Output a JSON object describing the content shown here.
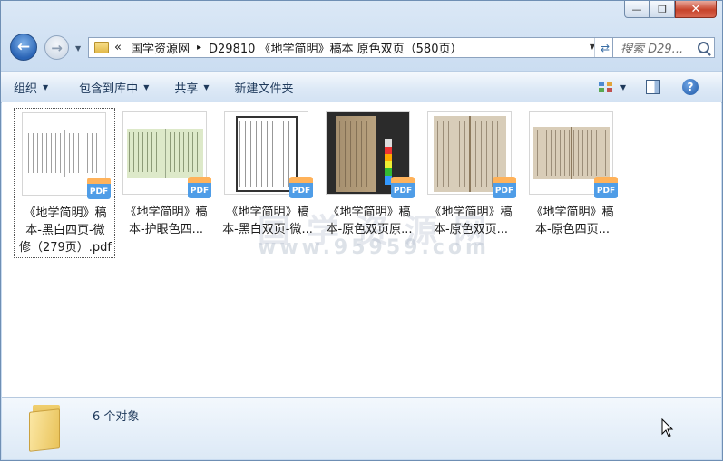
{
  "window": {
    "minimize_label": "—",
    "maximize_label": "❐",
    "close_label": "✕"
  },
  "address_bar": {
    "overflow_label": "«",
    "crumbs": [
      "国学资源网",
      "D29810 《地学简明》稿本 原色双页（580页）"
    ],
    "separator": "▸"
  },
  "search": {
    "placeholder": "搜索 D29..."
  },
  "toolbar": {
    "organize_label": "组织",
    "include_label": "包含到库中",
    "share_label": "共享",
    "new_folder_label": "新建文件夹"
  },
  "files": [
    {
      "name_line1": "《地学简明》稿",
      "name_line2": "本-黑白四页-微",
      "name_line3": "修（279页）.pdf",
      "badge": "PDF"
    },
    {
      "name_line1": "《地学简明》稿",
      "name_line2": "本-护眼色四...",
      "name_line3": "",
      "badge": "PDF"
    },
    {
      "name_line1": "《地学简明》稿",
      "name_line2": "本-黑白双页-微...",
      "name_line3": "",
      "badge": "PDF"
    },
    {
      "name_line1": "《地学简明》稿",
      "name_line2": "本-原色双页原...",
      "name_line3": "",
      "badge": "PDF"
    },
    {
      "name_line1": "《地学简明》稿",
      "name_line2": "本-原色双页...",
      "name_line3": "",
      "badge": "PDF"
    },
    {
      "name_line1": "《地学简明》稿",
      "name_line2": "本-原色四页...",
      "name_line3": "",
      "badge": "PDF"
    }
  ],
  "watermark": {
    "text": "国学资源网",
    "url": "www.95959.com"
  },
  "status_bar": {
    "count_text": "6 个对象"
  },
  "colors": {
    "accent": "#2a64b5",
    "pdf_top": "#ffb25a",
    "pdf_bottom": "#4f9de7"
  }
}
